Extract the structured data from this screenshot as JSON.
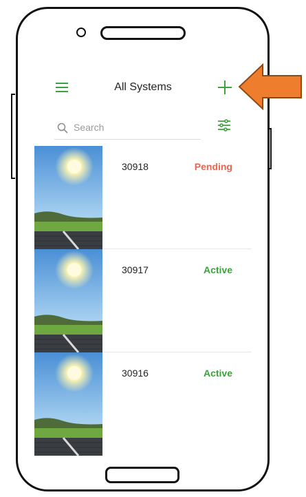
{
  "header": {
    "title": "All Systems",
    "menu_icon": "hamburger-menu-icon",
    "add_icon": "plus-icon"
  },
  "search": {
    "placeholder": "Search",
    "value": "",
    "icon": "search-icon",
    "filter_icon": "filter-sliders-icon"
  },
  "systems": [
    {
      "id": "30918",
      "status": "Pending",
      "status_type": "pending",
      "thumbnail": "solar-panel-sun-image"
    },
    {
      "id": "30917",
      "status": "Active",
      "status_type": "active",
      "thumbnail": "solar-panel-sun-image"
    },
    {
      "id": "30916",
      "status": "Active",
      "status_type": "active",
      "thumbnail": "solar-panel-sun-image"
    }
  ],
  "colors": {
    "accent_green": "#3ba33b",
    "pending_red": "#e8664f",
    "annotation_orange": "#ef7d2e"
  }
}
